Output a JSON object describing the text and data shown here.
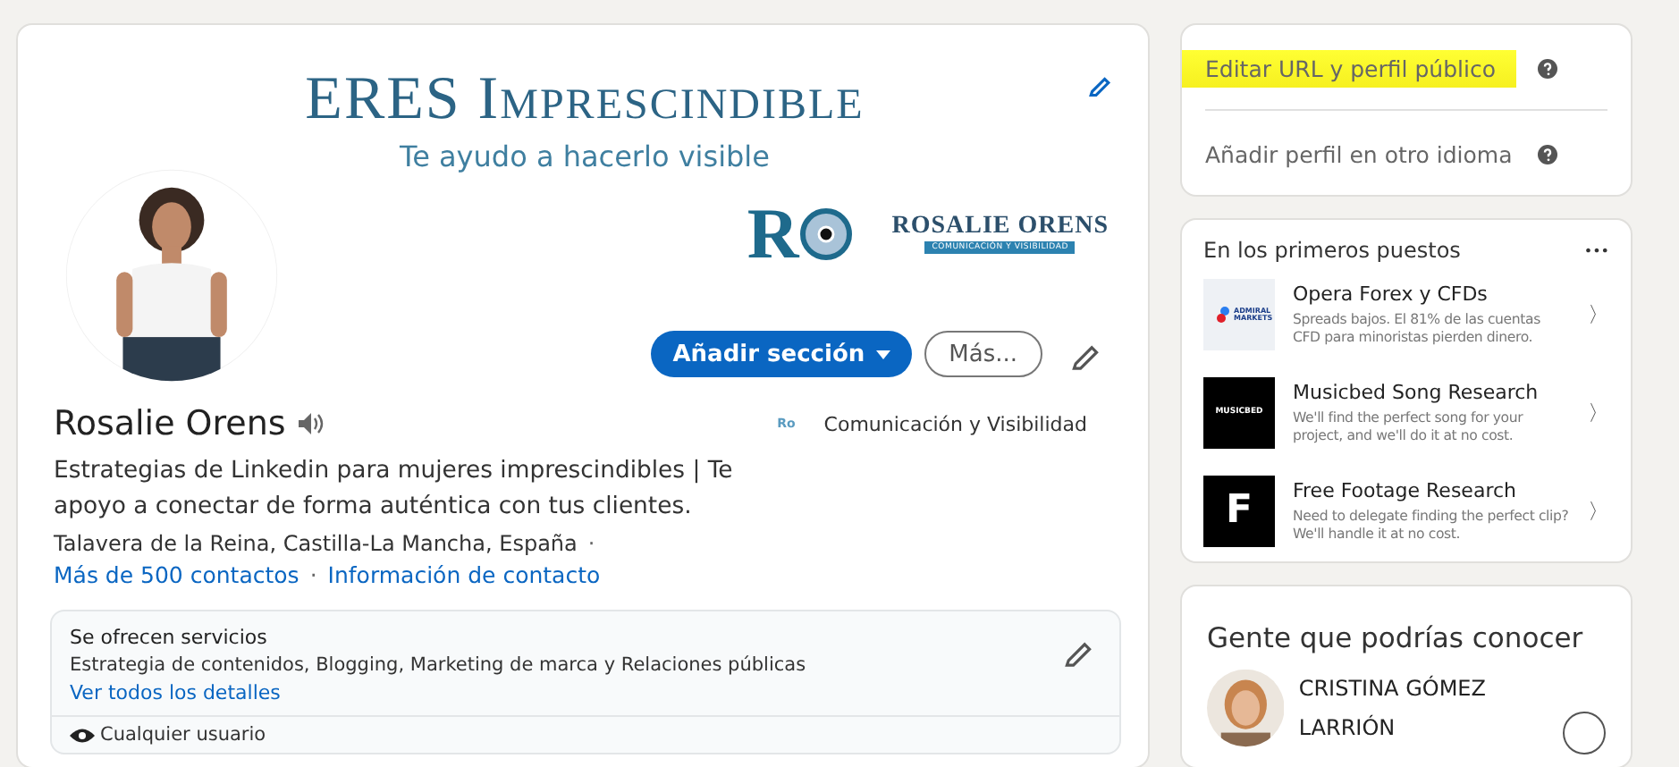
{
  "banner": {
    "title": "ERES Imprescindible",
    "subtitle": "Te ayudo a hacerlo visible",
    "logo_mark": "R",
    "brand_name": "ROSALIE ORENS",
    "brand_tagline": "COMUNICACIÓN Y VISIBILIDAD"
  },
  "actions": {
    "primary": "Añadir sección",
    "secondary": "Más..."
  },
  "profile": {
    "name": "Rosalie Orens",
    "company_logo": "Ro",
    "company": "Comunicación y Visibilidad",
    "headline": "Estrategias de Linkedin para mujeres imprescindibles | Te apoyo a conectar de forma auténtica con tus clientes.",
    "location": "Talavera de la Reina, Castilla-La Mancha, España",
    "separator_1": "·",
    "connections": "Más de 500 contactos",
    "separator_2": "·",
    "contact_info": "Información de contacto"
  },
  "services": {
    "title": "Se ofrecen servicios",
    "description": "Estrategia de contenidos, Blogging, Marketing de marca y Relaciones públicas",
    "link": "Ver todos los detalles",
    "visibility": "Cualquier usuario"
  },
  "profile_links": [
    {
      "label": "Editar URL y perfil público",
      "highlighted": true
    },
    {
      "label": "Añadir perfil en otro idioma",
      "highlighted": false
    }
  ],
  "ads": {
    "title": "En los primeros puestos",
    "more": "•••",
    "items": [
      {
        "kind": "dots",
        "logo_text": "ADMIRAL MARKETS",
        "title": "Opera Forex y CFDs",
        "text": "Spreads bajos. El 81% de las cuentas CFD para minoristas pierden dinero.",
        "arrow": "〉"
      },
      {
        "kind": "word",
        "logo_text": "MUSICBED",
        "title": "Musicbed Song Research",
        "text": "We'll find the perfect song for your project, and we'll do it at no cost.",
        "arrow": "〉"
      },
      {
        "kind": "letter",
        "logo_text": "F",
        "title": "Free Footage Research",
        "text": "Need to delegate finding the perfect clip? We'll handle it at no cost.",
        "arrow": "〉"
      }
    ]
  },
  "people": {
    "title": "Gente que podrías conocer",
    "items": [
      {
        "name": "CRISTINA GÓMEZ LARRIÓN"
      }
    ]
  }
}
